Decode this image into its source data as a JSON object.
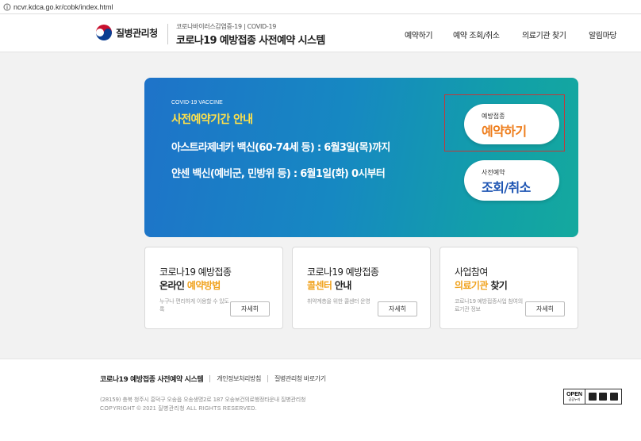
{
  "browser": {
    "url": "ncvr.kdca.go.kr/cobk/index.html"
  },
  "header": {
    "org_name": "질병관리청",
    "system_subtitle": "코로나바이러스감염증-19 | COVID-19",
    "system_title": "코로나19 예방접종 사전예약 시스템",
    "nav": [
      "예약하기",
      "예약 조회/취소",
      "의료기관 찾기",
      "알림마당"
    ]
  },
  "banner": {
    "eyebrow": "COVID-19 VACCINE",
    "headline": "사전예약기간 안내",
    "line1": "아스트라제네카 백신(60-74세 등) : 6월3일(목)까지",
    "line2": "얀센 백신(예비군, 민방위 등) : 6월1일(화) 0시부터",
    "reserve_button": {
      "sub": "예방접종",
      "main": "예약하기"
    },
    "query_button": {
      "sub": "사전예약",
      "main": "조회/취소"
    }
  },
  "cards": [
    {
      "line1": "코로나19 예방접종",
      "line2_bold": "온라인 ",
      "line2_highlight": "예약방법",
      "line2_tail": "",
      "desc": "누구나 편리하게 이용할 수 있도록",
      "button": "자세히"
    },
    {
      "line1": "코로나19 예방접종",
      "line2_bold": "",
      "line2_highlight": "콜센터",
      "line2_tail": " 안내",
      "desc": "취약계층을 위한 콜센터 운영",
      "button": "자세히"
    },
    {
      "line1": "사업참여",
      "line2_bold": "",
      "line2_highlight": "의료기관",
      "line2_tail": " 찾기",
      "desc": "코로나19 예방접종사업 참여의료기관 정보",
      "button": "자세히"
    }
  ],
  "footer": {
    "system_name": "코로나19 예방접종 사전예약 시스템",
    "links": [
      "개인정보처리방침",
      "질병관리청 바로가기"
    ],
    "address": "(28159) 충북 청주시 흥덕구 오송읍 오송생명2로 187 오송보건의료행정타운내 질병관리청",
    "copyright": "COPYRIGHT © 2021 질병관리청 ALL RIGHTS RESERVED.",
    "kogl": {
      "label": "OPEN",
      "sub": "공공누리"
    }
  },
  "colors": {
    "accent_orange": "#ee7d1b",
    "accent_blue": "#1e55b3",
    "banner_yellow": "#ffe14a",
    "card_highlight": "#f0a21d"
  }
}
